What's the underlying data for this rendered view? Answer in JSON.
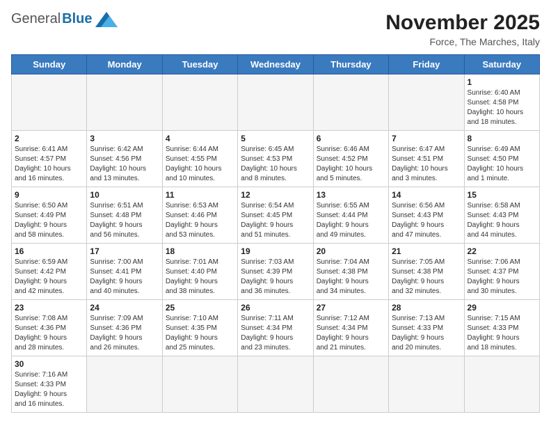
{
  "header": {
    "logo_general": "General",
    "logo_blue": "Blue",
    "title": "November 2025",
    "subtitle": "Force, The Marches, Italy"
  },
  "weekdays": [
    "Sunday",
    "Monday",
    "Tuesday",
    "Wednesday",
    "Thursday",
    "Friday",
    "Saturday"
  ],
  "weeks": [
    [
      {
        "day": "",
        "info": ""
      },
      {
        "day": "",
        "info": ""
      },
      {
        "day": "",
        "info": ""
      },
      {
        "day": "",
        "info": ""
      },
      {
        "day": "",
        "info": ""
      },
      {
        "day": "",
        "info": ""
      },
      {
        "day": "1",
        "info": "Sunrise: 6:40 AM\nSunset: 4:58 PM\nDaylight: 10 hours\nand 18 minutes."
      }
    ],
    [
      {
        "day": "2",
        "info": "Sunrise: 6:41 AM\nSunset: 4:57 PM\nDaylight: 10 hours\nand 16 minutes."
      },
      {
        "day": "3",
        "info": "Sunrise: 6:42 AM\nSunset: 4:56 PM\nDaylight: 10 hours\nand 13 minutes."
      },
      {
        "day": "4",
        "info": "Sunrise: 6:44 AM\nSunset: 4:55 PM\nDaylight: 10 hours\nand 10 minutes."
      },
      {
        "day": "5",
        "info": "Sunrise: 6:45 AM\nSunset: 4:53 PM\nDaylight: 10 hours\nand 8 minutes."
      },
      {
        "day": "6",
        "info": "Sunrise: 6:46 AM\nSunset: 4:52 PM\nDaylight: 10 hours\nand 5 minutes."
      },
      {
        "day": "7",
        "info": "Sunrise: 6:47 AM\nSunset: 4:51 PM\nDaylight: 10 hours\nand 3 minutes."
      },
      {
        "day": "8",
        "info": "Sunrise: 6:49 AM\nSunset: 4:50 PM\nDaylight: 10 hours\nand 1 minute."
      }
    ],
    [
      {
        "day": "9",
        "info": "Sunrise: 6:50 AM\nSunset: 4:49 PM\nDaylight: 9 hours\nand 58 minutes."
      },
      {
        "day": "10",
        "info": "Sunrise: 6:51 AM\nSunset: 4:48 PM\nDaylight: 9 hours\nand 56 minutes."
      },
      {
        "day": "11",
        "info": "Sunrise: 6:53 AM\nSunset: 4:46 PM\nDaylight: 9 hours\nand 53 minutes."
      },
      {
        "day": "12",
        "info": "Sunrise: 6:54 AM\nSunset: 4:45 PM\nDaylight: 9 hours\nand 51 minutes."
      },
      {
        "day": "13",
        "info": "Sunrise: 6:55 AM\nSunset: 4:44 PM\nDaylight: 9 hours\nand 49 minutes."
      },
      {
        "day": "14",
        "info": "Sunrise: 6:56 AM\nSunset: 4:43 PM\nDaylight: 9 hours\nand 47 minutes."
      },
      {
        "day": "15",
        "info": "Sunrise: 6:58 AM\nSunset: 4:43 PM\nDaylight: 9 hours\nand 44 minutes."
      }
    ],
    [
      {
        "day": "16",
        "info": "Sunrise: 6:59 AM\nSunset: 4:42 PM\nDaylight: 9 hours\nand 42 minutes."
      },
      {
        "day": "17",
        "info": "Sunrise: 7:00 AM\nSunset: 4:41 PM\nDaylight: 9 hours\nand 40 minutes."
      },
      {
        "day": "18",
        "info": "Sunrise: 7:01 AM\nSunset: 4:40 PM\nDaylight: 9 hours\nand 38 minutes."
      },
      {
        "day": "19",
        "info": "Sunrise: 7:03 AM\nSunset: 4:39 PM\nDaylight: 9 hours\nand 36 minutes."
      },
      {
        "day": "20",
        "info": "Sunrise: 7:04 AM\nSunset: 4:38 PM\nDaylight: 9 hours\nand 34 minutes."
      },
      {
        "day": "21",
        "info": "Sunrise: 7:05 AM\nSunset: 4:38 PM\nDaylight: 9 hours\nand 32 minutes."
      },
      {
        "day": "22",
        "info": "Sunrise: 7:06 AM\nSunset: 4:37 PM\nDaylight: 9 hours\nand 30 minutes."
      }
    ],
    [
      {
        "day": "23",
        "info": "Sunrise: 7:08 AM\nSunset: 4:36 PM\nDaylight: 9 hours\nand 28 minutes."
      },
      {
        "day": "24",
        "info": "Sunrise: 7:09 AM\nSunset: 4:36 PM\nDaylight: 9 hours\nand 26 minutes."
      },
      {
        "day": "25",
        "info": "Sunrise: 7:10 AM\nSunset: 4:35 PM\nDaylight: 9 hours\nand 25 minutes."
      },
      {
        "day": "26",
        "info": "Sunrise: 7:11 AM\nSunset: 4:34 PM\nDaylight: 9 hours\nand 23 minutes."
      },
      {
        "day": "27",
        "info": "Sunrise: 7:12 AM\nSunset: 4:34 PM\nDaylight: 9 hours\nand 21 minutes."
      },
      {
        "day": "28",
        "info": "Sunrise: 7:13 AM\nSunset: 4:33 PM\nDaylight: 9 hours\nand 20 minutes."
      },
      {
        "day": "29",
        "info": "Sunrise: 7:15 AM\nSunset: 4:33 PM\nDaylight: 9 hours\nand 18 minutes."
      }
    ],
    [
      {
        "day": "30",
        "info": "Sunrise: 7:16 AM\nSunset: 4:33 PM\nDaylight: 9 hours\nand 16 minutes."
      },
      {
        "day": "",
        "info": ""
      },
      {
        "day": "",
        "info": ""
      },
      {
        "day": "",
        "info": ""
      },
      {
        "day": "",
        "info": ""
      },
      {
        "day": "",
        "info": ""
      },
      {
        "day": "",
        "info": ""
      }
    ]
  ]
}
